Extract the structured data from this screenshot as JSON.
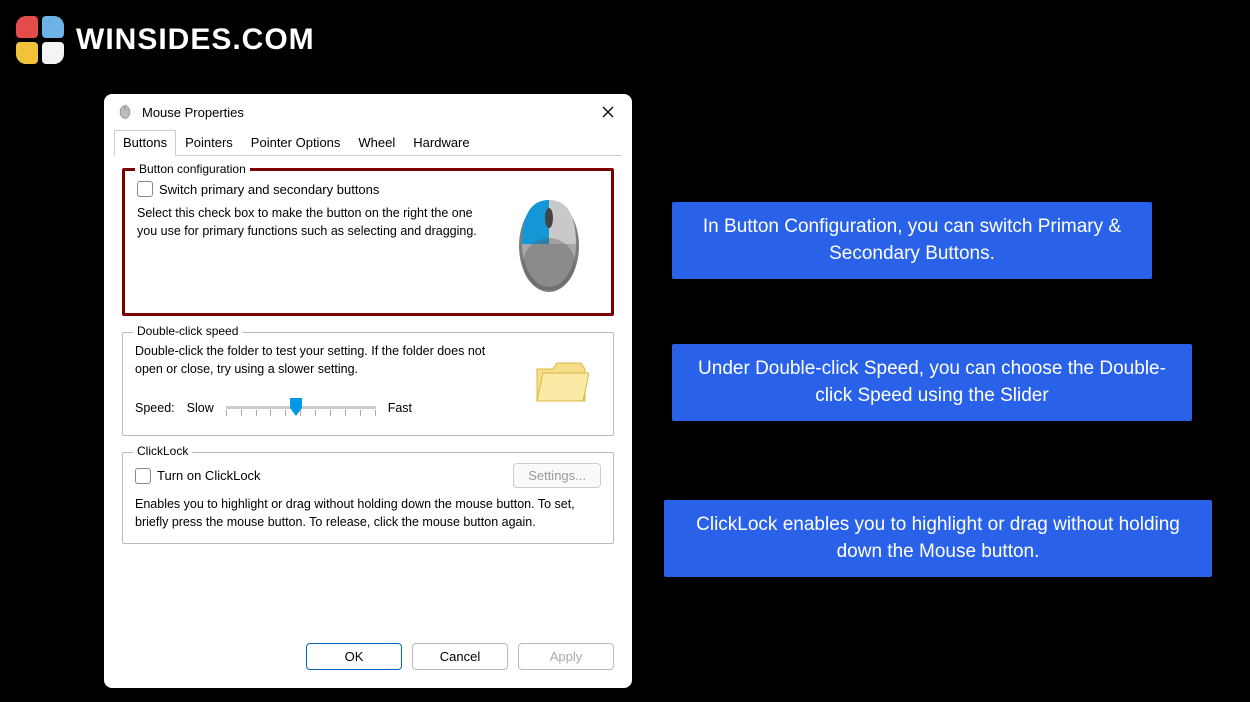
{
  "brand": {
    "name": "WINSIDES.COM"
  },
  "dialog": {
    "title": "Mouse Properties",
    "tabs": [
      "Buttons",
      "Pointers",
      "Pointer Options",
      "Wheel",
      "Hardware"
    ],
    "activeTab": 0,
    "buttonConfig": {
      "legend": "Button configuration",
      "checkboxLabel": "Switch primary and secondary buttons",
      "description": "Select this check box to make the button on the right the one you use for primary functions such as selecting and dragging."
    },
    "doubleClick": {
      "legend": "Double-click speed",
      "description": "Double-click the folder to test your setting. If the folder does not open or close, try using a slower setting.",
      "speedLabel": "Speed:",
      "slow": "Slow",
      "fast": "Fast"
    },
    "clickLock": {
      "legend": "ClickLock",
      "checkboxLabel": "Turn on ClickLock",
      "settingsBtn": "Settings...",
      "description": "Enables you to highlight or drag without holding down the mouse button. To set, briefly press the mouse button. To release, click the mouse button again."
    },
    "buttons": {
      "ok": "OK",
      "cancel": "Cancel",
      "apply": "Apply"
    }
  },
  "callouts": {
    "c1": "In Button Configuration, you can switch Primary & Secondary Buttons.",
    "c2": "Under Double-click Speed, you can choose the Double-click Speed using the Slider",
    "c3": "ClickLock enables you to highlight or drag without holding down the Mouse button."
  }
}
